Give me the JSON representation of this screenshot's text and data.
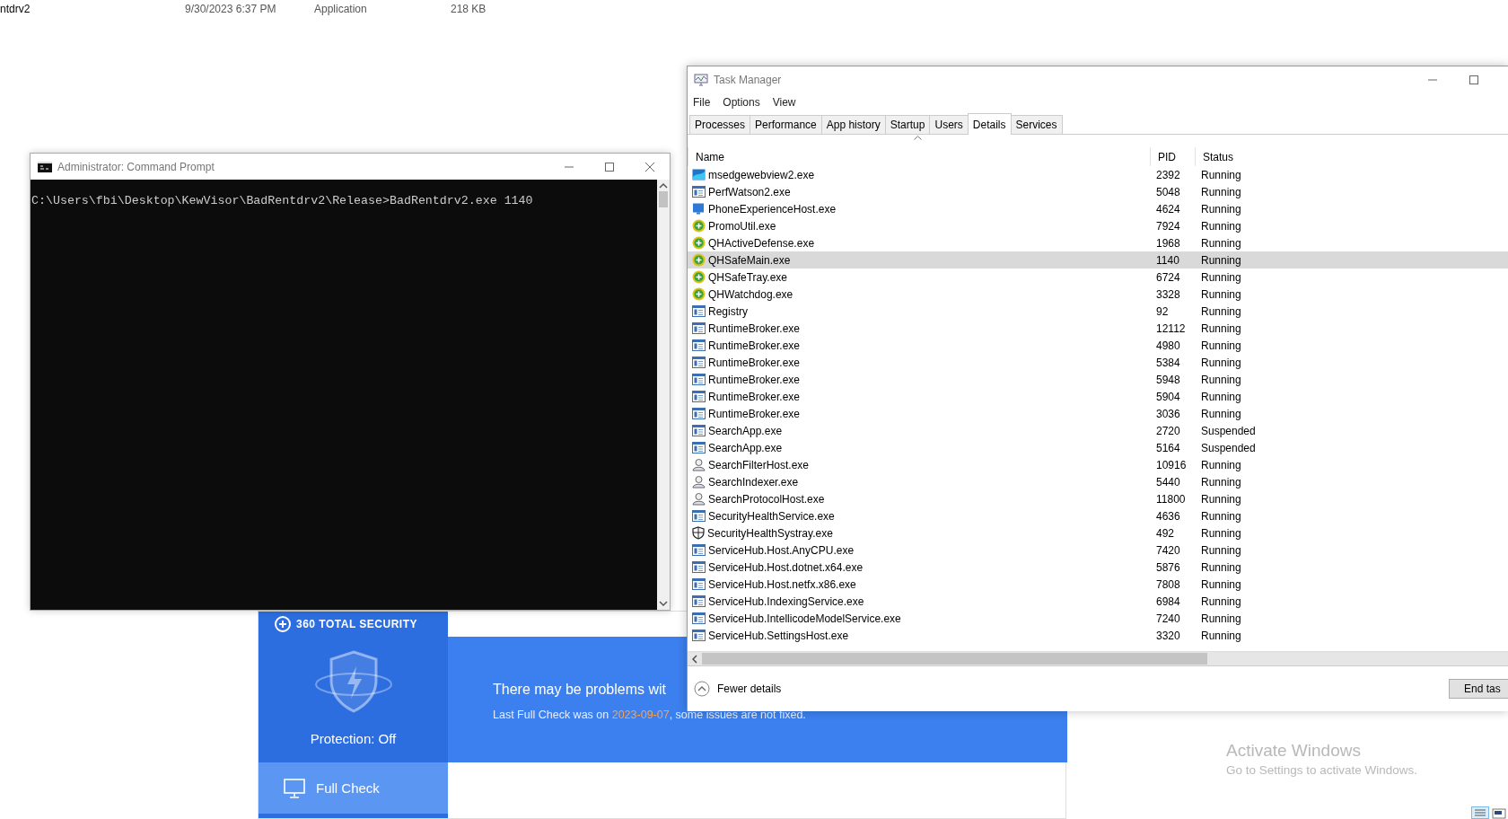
{
  "explorer_row": {
    "name": "ntdrv2",
    "date": "9/30/2023 6:37 PM",
    "type": "Application",
    "size": "218 KB"
  },
  "command_prompt": {
    "title": "Administrator: Command Prompt",
    "lines": [
      "C:\\Users\\fbi\\Desktop\\KewVisor\\BadRentdrv2\\Release>BadRentdrv2.exe 1140"
    ]
  },
  "security_app": {
    "brand": "360 TOTAL SECURITY",
    "protection": "Protection: Off",
    "nav": [
      {
        "label": "Full Check",
        "selected": true
      }
    ],
    "headline": "There may be problems wit",
    "last_check": {
      "before": "Last Full Check was on ",
      "date": "2023-09-07",
      "after": ", some issues are not fixed."
    }
  },
  "task_manager": {
    "title": "Task Manager",
    "menu": [
      "File",
      "Options",
      "View"
    ],
    "tabs": [
      {
        "label": "Processes",
        "selected": false
      },
      {
        "label": "Performance",
        "selected": false
      },
      {
        "label": "App history",
        "selected": false
      },
      {
        "label": "Startup",
        "selected": false
      },
      {
        "label": "Users",
        "selected": false
      },
      {
        "label": "Details",
        "selected": true
      },
      {
        "label": "Services",
        "selected": false
      }
    ],
    "columns": [
      "Name",
      "PID",
      "Status"
    ],
    "rows": [
      {
        "name": "msedgewebview2.exe",
        "pid": "2392",
        "status": "Running",
        "kind": "browser",
        "selected": false
      },
      {
        "name": "PerfWatson2.exe",
        "pid": "5048",
        "status": "Running",
        "kind": "app",
        "selected": false
      },
      {
        "name": "PhoneExperienceHost.exe",
        "pid": "4624",
        "status": "Running",
        "kind": "phone",
        "selected": false
      },
      {
        "name": "PromoUtil.exe",
        "pid": "7924",
        "status": "Running",
        "kind": "plus",
        "selected": false
      },
      {
        "name": "QHActiveDefense.exe",
        "pid": "1968",
        "status": "Running",
        "kind": "plus",
        "selected": false
      },
      {
        "name": "QHSafeMain.exe",
        "pid": "1140",
        "status": "Running",
        "kind": "plus",
        "selected": true
      },
      {
        "name": "QHSafeTray.exe",
        "pid": "6724",
        "status": "Running",
        "kind": "plus",
        "selected": false
      },
      {
        "name": "QHWatchdog.exe",
        "pid": "3328",
        "status": "Running",
        "kind": "plus",
        "selected": false
      },
      {
        "name": "Registry",
        "pid": "92",
        "status": "Running",
        "kind": "app",
        "selected": false
      },
      {
        "name": "RuntimeBroker.exe",
        "pid": "12112",
        "status": "Running",
        "kind": "app",
        "selected": false
      },
      {
        "name": "RuntimeBroker.exe",
        "pid": "4980",
        "status": "Running",
        "kind": "app",
        "selected": false
      },
      {
        "name": "RuntimeBroker.exe",
        "pid": "5384",
        "status": "Running",
        "kind": "app",
        "selected": false
      },
      {
        "name": "RuntimeBroker.exe",
        "pid": "5948",
        "status": "Running",
        "kind": "app",
        "selected": false
      },
      {
        "name": "RuntimeBroker.exe",
        "pid": "5904",
        "status": "Running",
        "kind": "app",
        "selected": false
      },
      {
        "name": "RuntimeBroker.exe",
        "pid": "3036",
        "status": "Running",
        "kind": "app",
        "selected": false
      },
      {
        "name": "SearchApp.exe",
        "pid": "2720",
        "status": "Suspended",
        "kind": "app",
        "selected": false
      },
      {
        "name": "SearchApp.exe",
        "pid": "5164",
        "status": "Suspended",
        "kind": "app",
        "selected": false
      },
      {
        "name": "SearchFilterHost.exe",
        "pid": "10916",
        "status": "Running",
        "kind": "user",
        "selected": false
      },
      {
        "name": "SearchIndexer.exe",
        "pid": "5440",
        "status": "Running",
        "kind": "user",
        "selected": false
      },
      {
        "name": "SearchProtocolHost.exe",
        "pid": "11800",
        "status": "Running",
        "kind": "user",
        "selected": false
      },
      {
        "name": "SecurityHealthService.exe",
        "pid": "4636",
        "status": "Running",
        "kind": "app",
        "selected": false
      },
      {
        "name": "SecurityHealthSystray.exe",
        "pid": "492",
        "status": "Running",
        "kind": "shield",
        "selected": false
      },
      {
        "name": "ServiceHub.Host.AnyCPU.exe",
        "pid": "7420",
        "status": "Running",
        "kind": "app",
        "selected": false
      },
      {
        "name": "ServiceHub.Host.dotnet.x64.exe",
        "pid": "5876",
        "status": "Running",
        "kind": "app",
        "selected": false
      },
      {
        "name": "ServiceHub.Host.netfx.x86.exe",
        "pid": "7808",
        "status": "Running",
        "kind": "app",
        "selected": false
      },
      {
        "name": "ServiceHub.IndexingService.exe",
        "pid": "6984",
        "status": "Running",
        "kind": "app",
        "selected": false
      },
      {
        "name": "ServiceHub.IntellicodeModelService.exe",
        "pid": "7240",
        "status": "Running",
        "kind": "app",
        "selected": false
      },
      {
        "name": "ServiceHub.SettingsHost.exe",
        "pid": "3320",
        "status": "Running",
        "kind": "app",
        "selected": false
      }
    ],
    "footer_link": "Fewer details",
    "end_button": "End tas"
  },
  "activation_notice": {
    "title": "Activate Windows",
    "subtitle": "Go to Settings to activate Windows."
  }
}
